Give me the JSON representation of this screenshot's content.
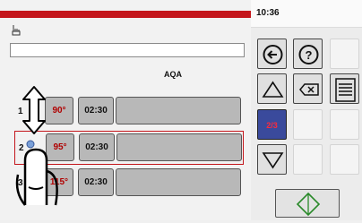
{
  "status": {
    "clock": "10:36"
  },
  "program": {
    "column_header": "AQA",
    "name_value": ""
  },
  "rows": [
    {
      "number": "1",
      "temperature": "90°",
      "time": "02:30",
      "selected": false
    },
    {
      "number": "2",
      "temperature": "95°",
      "time": "02:30",
      "selected": true
    },
    {
      "number": "3",
      "temperature": "115°",
      "time": "02:30",
      "selected": false
    }
  ],
  "navigation": {
    "page_indicator": "2/3"
  },
  "colors": {
    "accent_red": "#c4161c",
    "page_indicator_bg": "#3a4a9c",
    "temperature_text": "#b00000"
  },
  "icons": [
    "hand-pointer-icon",
    "back-arrow-icon",
    "help-icon",
    "arrow-up-icon",
    "backspace-icon",
    "list-icon",
    "arrow-down-icon",
    "start-icon",
    "swipe-gesture-icon"
  ]
}
